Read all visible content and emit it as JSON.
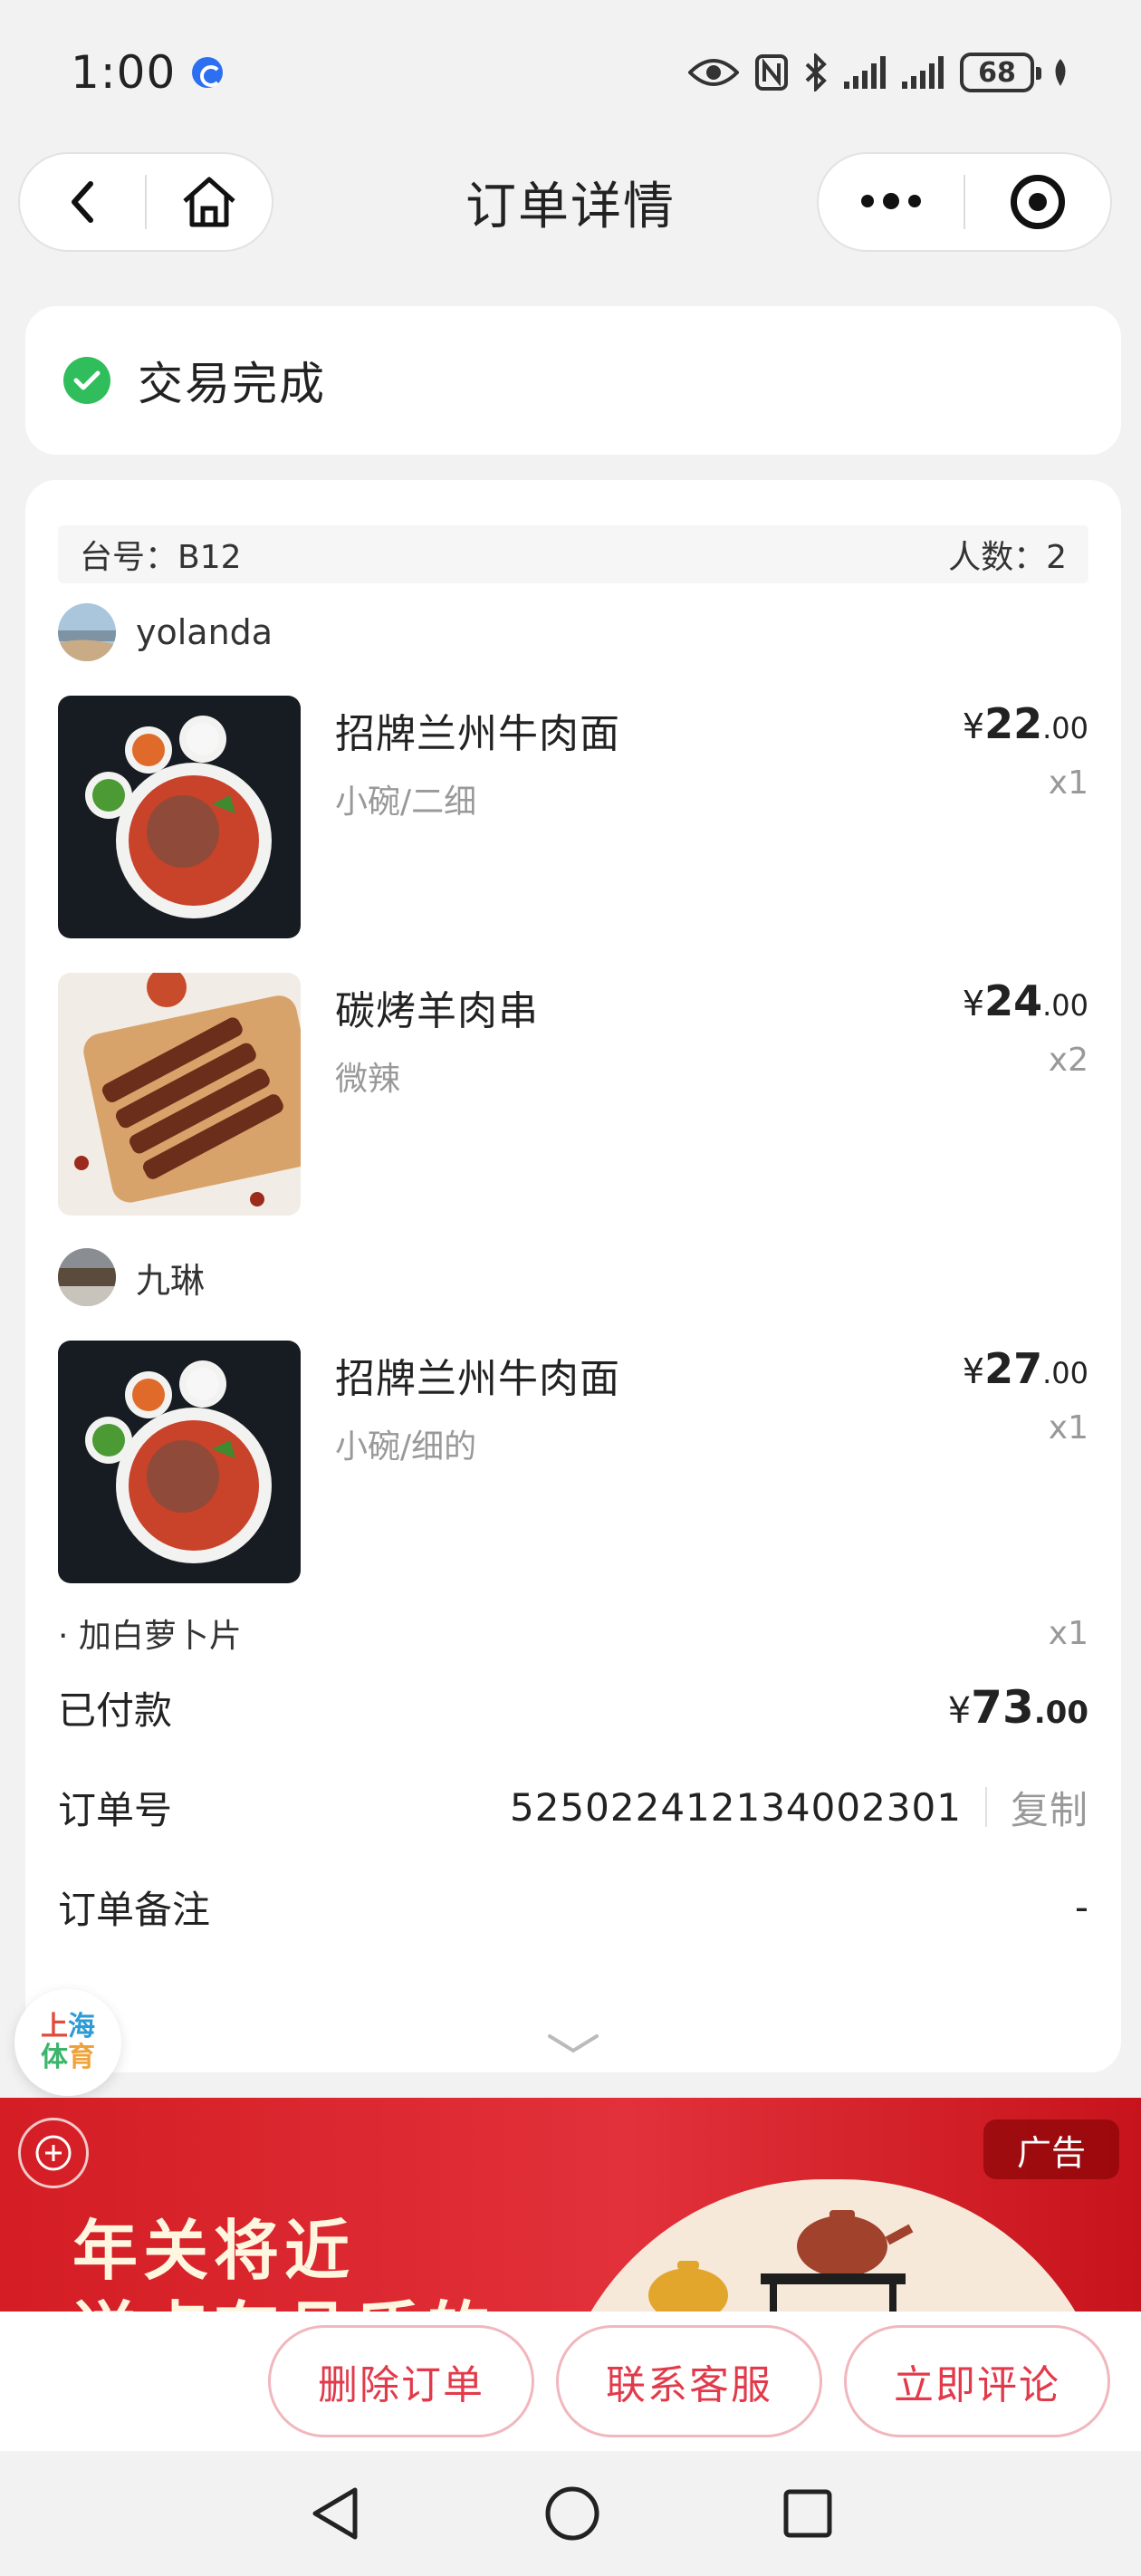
{
  "status_bar": {
    "time": "1:00",
    "battery": "68"
  },
  "nav": {
    "title": "订单详情"
  },
  "order_status": {
    "text": "交易完成"
  },
  "table_info": {
    "table_label": "台号：B12",
    "people_label": "人数：2"
  },
  "groups": [
    {
      "user": "yolanda",
      "items": [
        {
          "name": "招牌兰州牛肉面",
          "spec": "小碗/二细",
          "price_int": "22",
          "price_dec": ".00",
          "qty": "x1"
        },
        {
          "name": "碳烤羊肉串",
          "spec": "微辣",
          "price_int": "24",
          "price_dec": ".00",
          "qty": "x2"
        }
      ]
    },
    {
      "user": "九琳",
      "items": [
        {
          "name": "招牌兰州牛肉面",
          "spec": "小碗/细的",
          "price_int": "27",
          "price_dec": ".00",
          "qty": "x1"
        }
      ]
    }
  ],
  "addon": {
    "name": "· 加白萝卜片",
    "qty": "x1"
  },
  "summary": {
    "paid_label": "已付款",
    "currency": "¥",
    "paid_int": "73",
    "paid_dec": ".00",
    "order_no_label": "订单号",
    "order_no": "525022412134002301",
    "copy_label": "复制",
    "remark_label": "订单备注",
    "remark_value": "-"
  },
  "float_badge": {
    "line1a": "上",
    "line1b": "海",
    "line2a": "体",
    "line2b": "育"
  },
  "ad": {
    "badge": "广告",
    "headline_line1": "年关将近",
    "headline_line2": "送点有品质的"
  },
  "actions": {
    "delete": "删除订单",
    "contact": "联系客服",
    "review": "立即评论"
  },
  "colors": {
    "success": "#2fbe5b",
    "accent": "#e23a4b",
    "ad_red": "#d41d24"
  }
}
